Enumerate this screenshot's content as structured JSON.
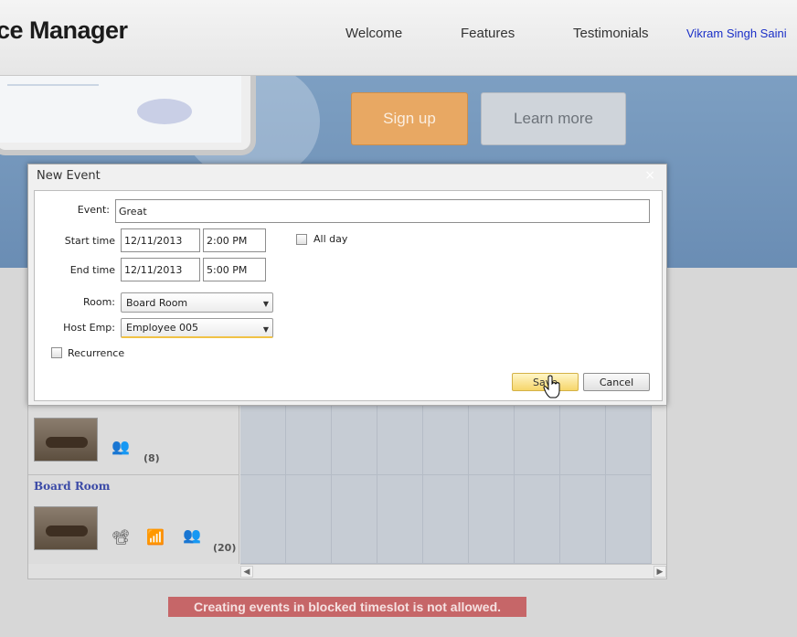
{
  "header": {
    "brand": "ce Manager",
    "nav": [
      "Welcome",
      "Features",
      "Testimonials"
    ],
    "user": "Vikram Singh Saini"
  },
  "hero": {
    "signup_label": "Sign up",
    "learn_label": "Learn more"
  },
  "dialog": {
    "title": "New Event",
    "close_glyph": "×",
    "event_label": "Event:",
    "event_value": "Great",
    "start_label": "Start time",
    "start_date": "12/11/2013",
    "start_time": "2:00 PM",
    "end_label": "End time",
    "end_date": "12/11/2013",
    "end_time": "5:00 PM",
    "allday_label": "All day",
    "room_label": "Room:",
    "room_value": "Board Room",
    "host_label": "Host Emp:",
    "host_value": "Employee 005",
    "recurrence_label": "Recurrence",
    "save_label": "Save",
    "cancel_label": "Cancel"
  },
  "scheduler": {
    "rooms": [
      {
        "name": "",
        "capacity": "(8)"
      },
      {
        "name": "Board Room",
        "capacity": "(20)"
      }
    ]
  },
  "error_message": "Creating events in blocked timeslot is not allowed.",
  "colors": {
    "accent_orange": "#e8a863",
    "link_blue": "#1a2fc7",
    "error_bg": "#c66668",
    "save_yellow": "#f6d56a"
  }
}
